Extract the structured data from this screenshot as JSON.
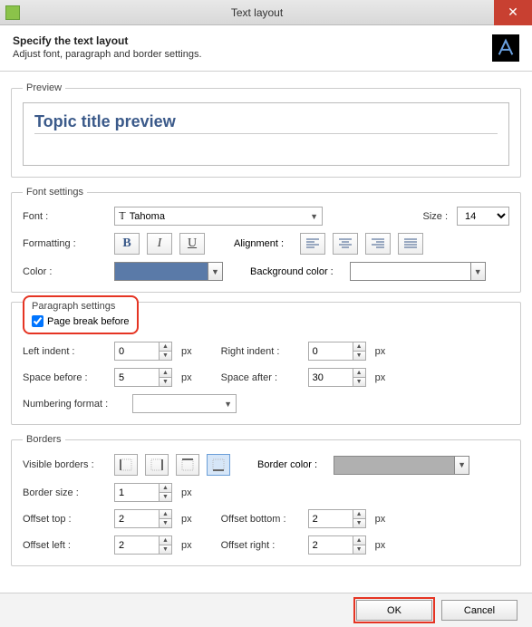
{
  "window": {
    "title": "Text layout"
  },
  "header": {
    "title": "Specify the text layout",
    "desc": "Adjust font, paragraph and border settings."
  },
  "preview": {
    "legend": "Preview",
    "text": "Topic title preview"
  },
  "font": {
    "legend": "Font settings",
    "font_label": "Font :",
    "font_value": "Tahoma",
    "size_label": "Size :",
    "size_value": "14",
    "formatting_label": "Formatting :",
    "alignment_label": "Alignment :",
    "color_label": "Color :",
    "color_value": "#5a7aa8",
    "bgcolor_label": "Background color :",
    "bgcolor_value": "#ffffff"
  },
  "paragraph": {
    "legend": "Paragraph settings",
    "page_break_label": "Page break before",
    "page_break_checked": true,
    "left_indent_label": "Left indent :",
    "left_indent": "0",
    "right_indent_label": "Right indent :",
    "right_indent": "0",
    "space_before_label": "Space before :",
    "space_before": "5",
    "space_after_label": "Space after :",
    "space_after": "30",
    "numbering_label": "Numbering format :",
    "numbering_value": ""
  },
  "borders": {
    "legend": "Borders",
    "visible_label": "Visible borders :",
    "border_color_label": "Border color :",
    "border_color_value": "#b0b0b0",
    "border_size_label": "Border size :",
    "border_size": "1",
    "offset_top_label": "Offset top :",
    "offset_top": "2",
    "offset_bottom_label": "Offset bottom :",
    "offset_bottom": "2",
    "offset_left_label": "Offset left :",
    "offset_left": "2",
    "offset_right_label": "Offset right :",
    "offset_right": "2"
  },
  "unit": "px",
  "footer": {
    "ok": "OK",
    "cancel": "Cancel"
  }
}
